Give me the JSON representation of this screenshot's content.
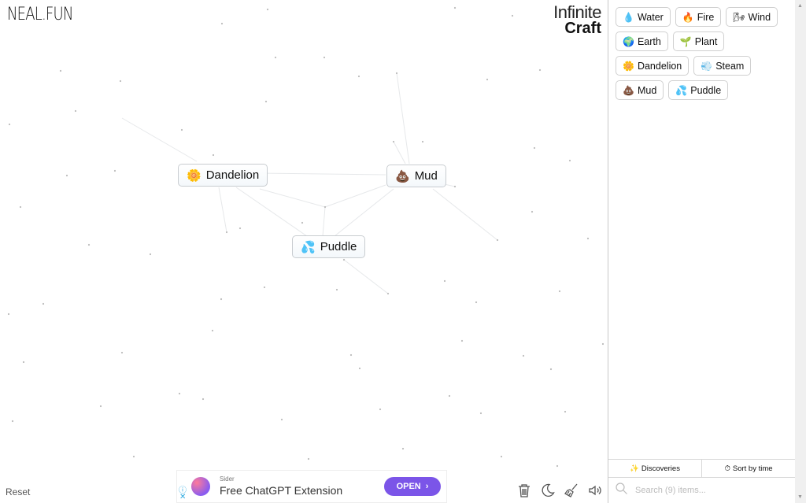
{
  "logo": "NEAL.FUN",
  "title": {
    "line1": "Infinite",
    "line2": "Craft"
  },
  "canvas_elements": [
    {
      "label": "Dandelion",
      "icon": "🌼",
      "icon_name": "flower-icon"
    },
    {
      "label": "Mud",
      "icon": "💩",
      "icon_name": "mud-icon"
    },
    {
      "label": "Puddle",
      "icon": "💦",
      "icon_name": "droplets-icon"
    }
  ],
  "sidebar": {
    "items": [
      {
        "label": "Water",
        "icon": "💧",
        "icon_name": "water-drop-icon"
      },
      {
        "label": "Fire",
        "icon": "🔥",
        "icon_name": "fire-icon"
      },
      {
        "label": "Wind",
        "icon": "🌬",
        "icon_name": "wind-icon"
      },
      {
        "label": "Earth",
        "icon": "🌍",
        "icon_name": "earth-icon"
      },
      {
        "label": "Plant",
        "icon": "🌱",
        "icon_name": "plant-icon"
      },
      {
        "label": "Dandelion",
        "icon": "🌼",
        "icon_name": "flower-icon"
      },
      {
        "label": "Steam",
        "icon": "💨",
        "icon_name": "steam-icon"
      },
      {
        "label": "Mud",
        "icon": "💩",
        "icon_name": "mud-icon"
      },
      {
        "label": "Puddle",
        "icon": "💦",
        "icon_name": "droplets-icon"
      }
    ],
    "tabs": {
      "discoveries": "Discoveries",
      "sort": "Sort by time"
    },
    "search_placeholder": "Search (9) items..."
  },
  "footer": {
    "reset": "Reset"
  },
  "ad": {
    "brand": "Sider",
    "headline": "Free ChatGPT Extension",
    "cta": "OPEN"
  }
}
